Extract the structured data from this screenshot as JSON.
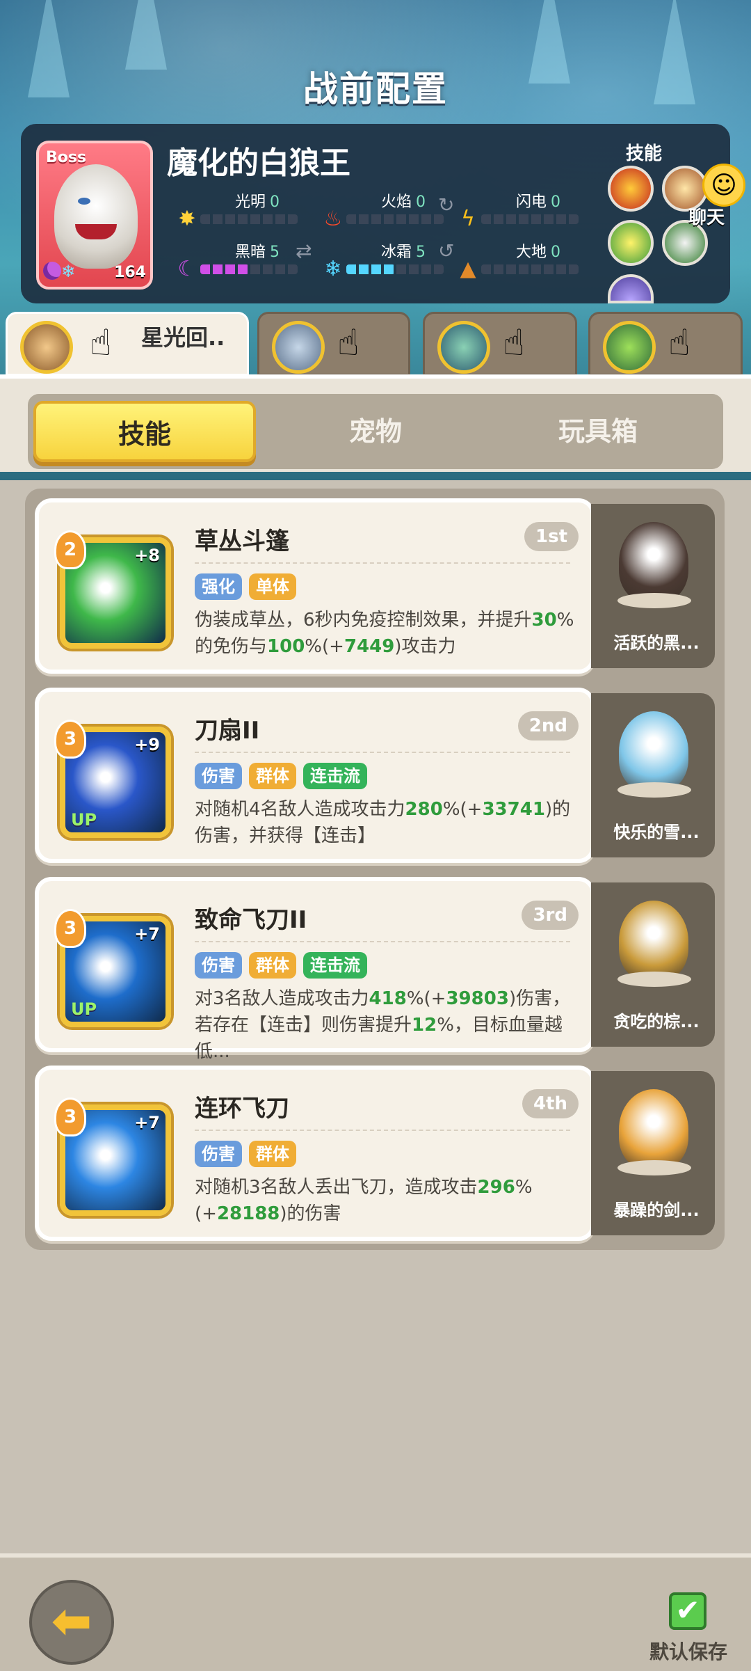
{
  "page_title": "战前配置",
  "boss": {
    "tag": "Boss",
    "name": "魔化的白狼王",
    "level": "164",
    "stats": [
      {
        "name": "光明",
        "value": "0",
        "icon": "sun-icon",
        "fill": 0,
        "color": "#ffd23a"
      },
      {
        "name": "火焰",
        "value": "0",
        "icon": "flame-icon",
        "fill": 0,
        "color": "#ff4a2a"
      },
      {
        "name": "闪电",
        "value": "0",
        "icon": "lightning-icon",
        "fill": 0,
        "color": "#ffc21a"
      },
      {
        "name": "黑暗",
        "value": "5",
        "icon": "moon-icon",
        "fill": 0.5,
        "color": "#d04fe8"
      },
      {
        "name": "冰霜",
        "value": "5",
        "icon": "snowflake-icon",
        "fill": 0.5,
        "color": "#55d6ff"
      },
      {
        "name": "大地",
        "value": "0",
        "icon": "mountain-icon",
        "fill": 0,
        "color": "#e28a2a"
      }
    ],
    "skills_label": "技能"
  },
  "chat": {
    "label": "聊天",
    "icon": "chat-emoji-icon"
  },
  "hero_tabs": [
    {
      "name": "星光回..",
      "active": true
    },
    {
      "name": "",
      "active": false
    },
    {
      "name": "",
      "active": false
    },
    {
      "name": "",
      "active": false
    }
  ],
  "tabs": [
    {
      "label": "技能",
      "active": true
    },
    {
      "label": "宠物",
      "active": false
    },
    {
      "label": "玩具箱",
      "active": false
    }
  ],
  "skills": [
    {
      "level": "2",
      "plus": "+8",
      "up": "",
      "title": "草丛斗篷",
      "rank": "1st",
      "tags": [
        {
          "text": "强化",
          "color": "blue"
        },
        {
          "text": "单体",
          "color": "orange"
        }
      ],
      "desc_parts": [
        {
          "t": "伪装成草丛，6秒内免疫控制效果，并提升",
          "g": false
        },
        {
          "t": "30",
          "g": true
        },
        {
          "t": "%的免伤与",
          "g": false
        },
        {
          "t": "100",
          "g": true
        },
        {
          "t": "%(+",
          "g": false
        },
        {
          "t": "7449",
          "g": true
        },
        {
          "t": ")攻击力",
          "g": false
        }
      ],
      "pet_name": "活跃的黑...",
      "icon_color": "#3fb84a"
    },
    {
      "level": "3",
      "plus": "+9",
      "up": "UP",
      "title": "刀扇II",
      "rank": "2nd",
      "tags": [
        {
          "text": "伤害",
          "color": "blue"
        },
        {
          "text": "群体",
          "color": "orange"
        },
        {
          "text": "连击流",
          "color": "green"
        }
      ],
      "desc_parts": [
        {
          "t": "对随机4名敌人造成攻击力",
          "g": false
        },
        {
          "t": "280",
          "g": true
        },
        {
          "t": "%(+",
          "g": false
        },
        {
          "t": "33741",
          "g": true
        },
        {
          "t": ")的伤害，并获得【连击】",
          "g": false
        }
      ],
      "pet_name": "快乐的雪...",
      "icon_color": "#2a57c9"
    },
    {
      "level": "3",
      "plus": "+7",
      "up": "UP",
      "title": "致命飞刀II",
      "rank": "3rd",
      "tags": [
        {
          "text": "伤害",
          "color": "blue"
        },
        {
          "text": "群体",
          "color": "orange"
        },
        {
          "text": "连击流",
          "color": "green"
        }
      ],
      "desc_parts": [
        {
          "t": "对3名敌人造成攻击力",
          "g": false
        },
        {
          "t": "418",
          "g": true
        },
        {
          "t": "%(+",
          "g": false
        },
        {
          "t": "39803",
          "g": true
        },
        {
          "t": ")伤害，若存在【连击】则伤害提升",
          "g": false
        },
        {
          "t": "12",
          "g": true
        },
        {
          "t": "%，目标血量越低...",
          "g": false
        }
      ],
      "pet_name": "贪吃的棕...",
      "icon_color": "#1e6dcb"
    },
    {
      "level": "3",
      "plus": "+7",
      "up": "",
      "title": "连环飞刀",
      "rank": "4th",
      "tags": [
        {
          "text": "伤害",
          "color": "blue"
        },
        {
          "text": "群体",
          "color": "orange"
        }
      ],
      "desc_parts": [
        {
          "t": "对随机3名敌人丢出飞刀，造成攻击",
          "g": false
        },
        {
          "t": "296",
          "g": true
        },
        {
          "t": "%(+",
          "g": false
        },
        {
          "t": "28188",
          "g": true
        },
        {
          "t": ")的伤害",
          "g": false
        }
      ],
      "pet_name": "暴躁的剑...",
      "icon_color": "#2d86e3"
    }
  ],
  "footer": {
    "back_icon": "back-arrow-icon",
    "save_label": "默认保存",
    "save_checked": true
  }
}
